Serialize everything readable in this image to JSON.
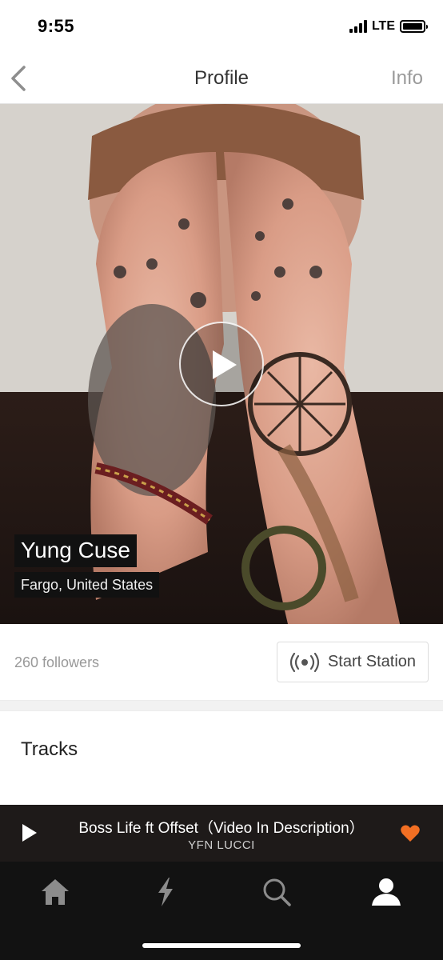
{
  "status_bar": {
    "time": "9:55",
    "network": "LTE",
    "signal_icon": "cellular-signal-icon",
    "battery_icon": "battery-icon"
  },
  "nav": {
    "title": "Profile",
    "info_label": "Info",
    "back_icon": "chevron-left-icon"
  },
  "hero": {
    "artist_name": "Yung Cuse",
    "location": "Fargo, United States",
    "play_icon": "play-icon"
  },
  "profile_stats": {
    "followers": "260 followers",
    "station_label": "Start Station",
    "station_icon": "broadcast-icon"
  },
  "tracks": {
    "heading": "Tracks"
  },
  "mini_player": {
    "title": "Boss Life ft Offset（Video In Description）",
    "artist": "YFN LUCCI",
    "liked": true,
    "accent_color": "#f26f23"
  },
  "tab_bar": {
    "items": [
      {
        "icon": "home-icon",
        "active": false
      },
      {
        "icon": "lightning-icon",
        "active": false
      },
      {
        "icon": "search-icon",
        "active": false
      },
      {
        "icon": "profile-icon",
        "active": true
      }
    ]
  }
}
